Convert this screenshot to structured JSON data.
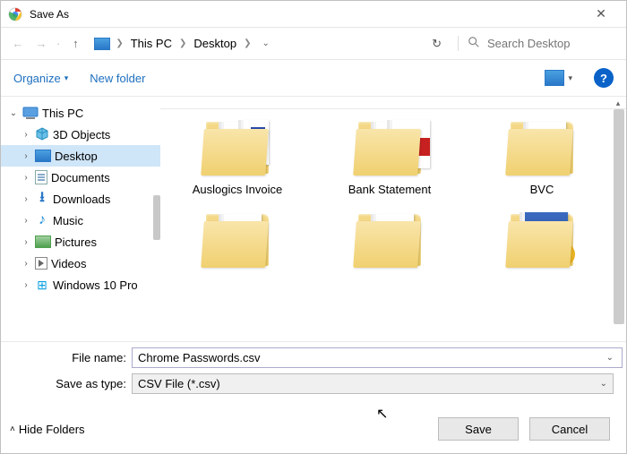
{
  "titlebar": {
    "title": "Save As",
    "close": "✕"
  },
  "nav": {
    "bc_root": "This PC",
    "bc_current": "Desktop",
    "search_placeholder": "Search Desktop"
  },
  "toolbar": {
    "organize": "Organize",
    "new_folder": "New folder",
    "help": "?"
  },
  "tree": {
    "root": "This PC",
    "items": [
      "3D Objects",
      "Desktop",
      "Documents",
      "Downloads",
      "Music",
      "Pictures",
      "Videos",
      "Windows 10 Pro"
    ]
  },
  "folders": {
    "row1": [
      "Auslogics Invoice",
      "Bank Statement",
      "BVC"
    ],
    "row2": [
      "",
      "",
      ""
    ]
  },
  "fields": {
    "filename_label": "File name:",
    "filename_value": "Chrome Passwords.csv",
    "type_label": "Save as type:",
    "type_value": "CSV File (*.csv)"
  },
  "footer": {
    "hide_folders": "Hide Folders",
    "save": "Save",
    "cancel": "Cancel"
  }
}
